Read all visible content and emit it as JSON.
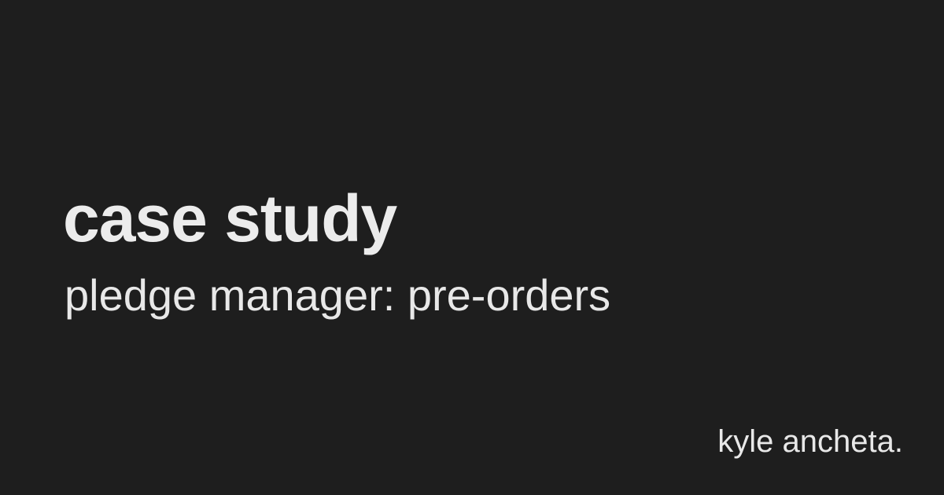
{
  "title": "case study",
  "subtitle": "pledge manager: pre-orders",
  "author": "kyle ancheta."
}
